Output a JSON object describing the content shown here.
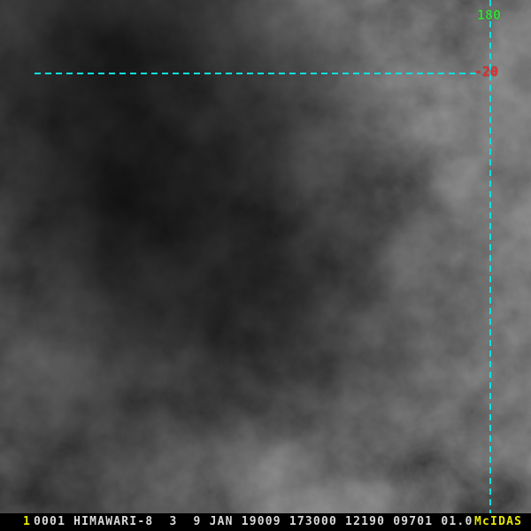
{
  "window": {
    "app": "McIDAS image display"
  },
  "graticule": {
    "lon_label": "180",
    "lat_label": "-20"
  },
  "status_bar": {
    "frame_number": "1",
    "text": "0001 HIMAWARI-8  3  9 JAN 19009 173000 12190 09701 01.0",
    "brand": "McIDAS"
  },
  "colors": {
    "graticule_line": "#12dede",
    "lon_label": "#3cd73c",
    "lat_label": "#e03232",
    "frame_number": "#e6e600",
    "status_text": "#d9d9d9",
    "brand": "#e6e600",
    "status_bar_bg": "#000000"
  }
}
